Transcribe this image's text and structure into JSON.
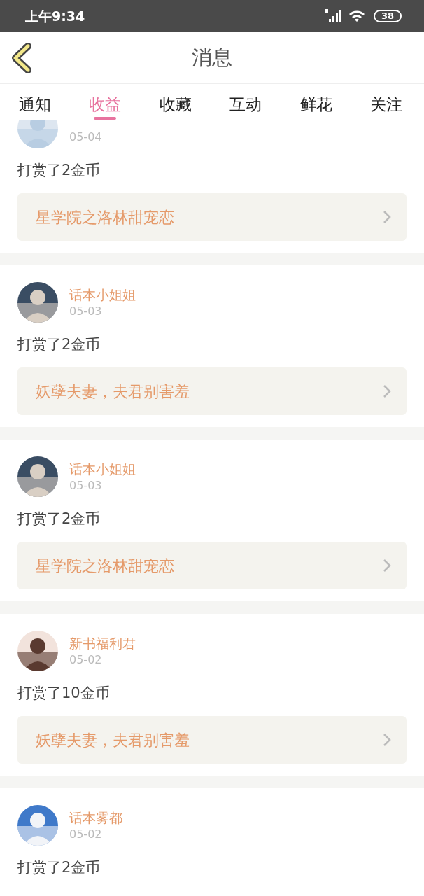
{
  "status_bar": {
    "time": "上午9:34",
    "battery": "38"
  },
  "header": {
    "title": "消息"
  },
  "tabs": [
    {
      "label": "通知",
      "selected": false
    },
    {
      "label": "收益",
      "selected": true
    },
    {
      "label": "收藏",
      "selected": false
    },
    {
      "label": "互动",
      "selected": false
    },
    {
      "label": "鲜花",
      "selected": false
    },
    {
      "label": "关注",
      "selected": false
    }
  ],
  "items": [
    {
      "date": "05-04",
      "message": "打赏了2金币",
      "book": "星学院之洛林甜宠恋"
    },
    {
      "name": "话本小姐姐",
      "date": "05-03",
      "message": "打赏了2金币",
      "book": "妖孽夫妻，夫君别害羞"
    },
    {
      "name": "话本小姐姐",
      "date": "05-03",
      "message": "打赏了2金币",
      "book": "星学院之洛林甜宠恋"
    },
    {
      "name": "新书福利君",
      "date": "05-02",
      "message": "打赏了10金币",
      "book": "妖孽夫妻，夫君别害羞"
    },
    {
      "name": "话本雾都",
      "date": "05-02",
      "message": "打赏了2金币"
    }
  ]
}
